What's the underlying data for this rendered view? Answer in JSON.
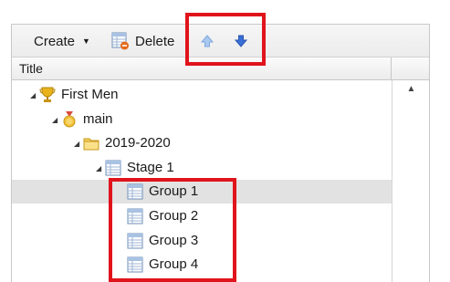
{
  "toolbar": {
    "create_label": "Create",
    "delete_label": "Delete",
    "up_icon": "arrow-up-icon",
    "down_icon": "arrow-down-icon"
  },
  "grid": {
    "column_title": "Title"
  },
  "tree": [
    {
      "label": "First Men",
      "icon": "trophy-icon",
      "level": 0,
      "expanded": true,
      "selected": false
    },
    {
      "label": "main",
      "icon": "medal-icon",
      "level": 1,
      "expanded": true,
      "selected": false
    },
    {
      "label": "2019-2020",
      "icon": "folder-icon",
      "level": 2,
      "expanded": true,
      "selected": false
    },
    {
      "label": "Stage 1",
      "icon": "table-icon",
      "level": 3,
      "expanded": true,
      "selected": false
    },
    {
      "label": "Group 1",
      "icon": "table-icon",
      "level": 4,
      "expanded": false,
      "selected": true
    },
    {
      "label": "Group 2",
      "icon": "table-icon",
      "level": 4,
      "expanded": false,
      "selected": false
    },
    {
      "label": "Group 3",
      "icon": "table-icon",
      "level": 4,
      "expanded": false,
      "selected": false
    },
    {
      "label": "Group 4",
      "icon": "table-icon",
      "level": 4,
      "expanded": false,
      "selected": false
    }
  ],
  "colors": {
    "highlight": "#e0141c",
    "selection": "#e2e2e2",
    "arrow_blue": "#3a6fd8"
  }
}
